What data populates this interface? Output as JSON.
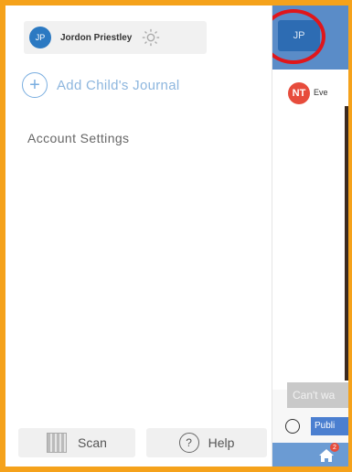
{
  "drawer": {
    "user": {
      "initials": "JP",
      "name": "Jordon Priestley"
    },
    "add_journal_label": "Add Child's Journal",
    "account_settings_label": "Account Settings",
    "footer": {
      "scan_label": "Scan",
      "help_label": "Help",
      "help_glyph": "?"
    }
  },
  "peek": {
    "header_avatar": "JP",
    "entry_initials": "NT",
    "entry_text": "Eve",
    "input_text": "Can't wa",
    "visibility_label": "Publi",
    "notification_count": "2"
  },
  "colors": {
    "frame": "#f5a21b",
    "accent": "#2b79c2",
    "highlight_ring": "#e0161b"
  }
}
